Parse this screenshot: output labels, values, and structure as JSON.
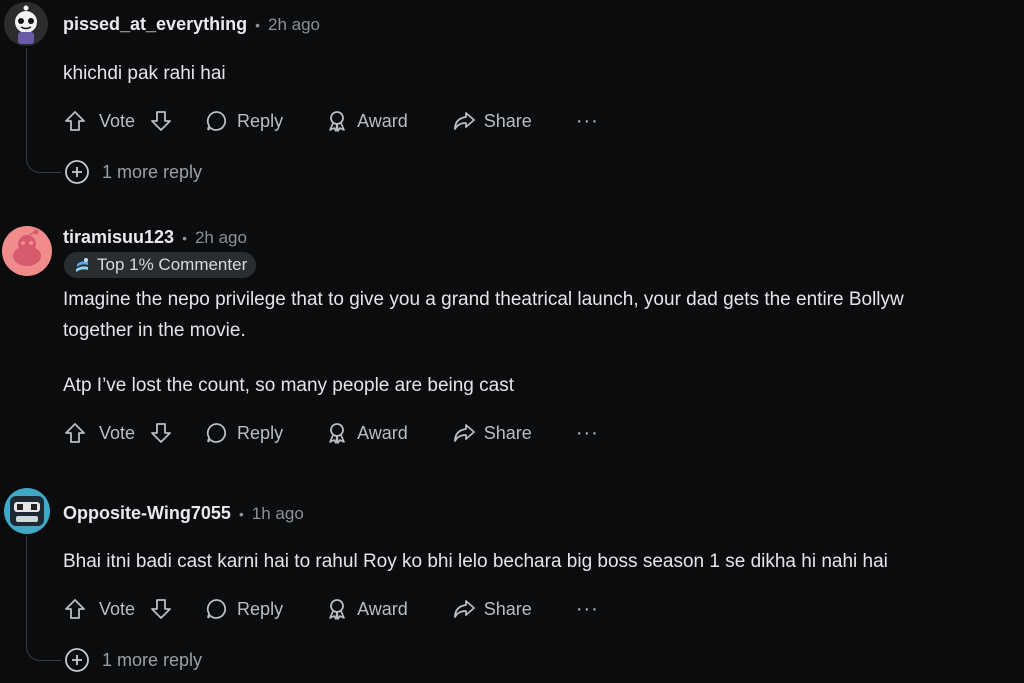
{
  "colors": {
    "background": "#0b0c0d",
    "text": "#e3e5e8",
    "muted": "#8b9196",
    "action": "#b9bec3",
    "badge_bg": "#2a2d30"
  },
  "actions": {
    "vote": "Vote",
    "reply": "Reply",
    "award": "Award",
    "share": "Share",
    "more": "···"
  },
  "comments": [
    {
      "username": "pissed_at_everything",
      "separator": "•",
      "time": "2h ago",
      "lines": [
        "khichdi pak rahi hai"
      ],
      "more_replies": "1 more reply"
    },
    {
      "username": "tiramisuu123",
      "separator": "•",
      "time": "2h ago",
      "badge": "Top 1% Commenter",
      "lines": [
        "Imagine the nepo privilege that to give you a grand theatrical launch, your dad gets the entire Bollyw",
        "together in the movie.",
        "Atp I’ve lost the count, so many people are being cast"
      ]
    },
    {
      "username": "Opposite-Wing7055",
      "separator": "•",
      "time": "1h ago",
      "lines": [
        "Bhai itni badi cast karni hai to rahul Roy ko bhi lelo bechara big boss season 1 se dikha hi nahi hai"
      ],
      "more_replies": "1 more reply"
    }
  ]
}
